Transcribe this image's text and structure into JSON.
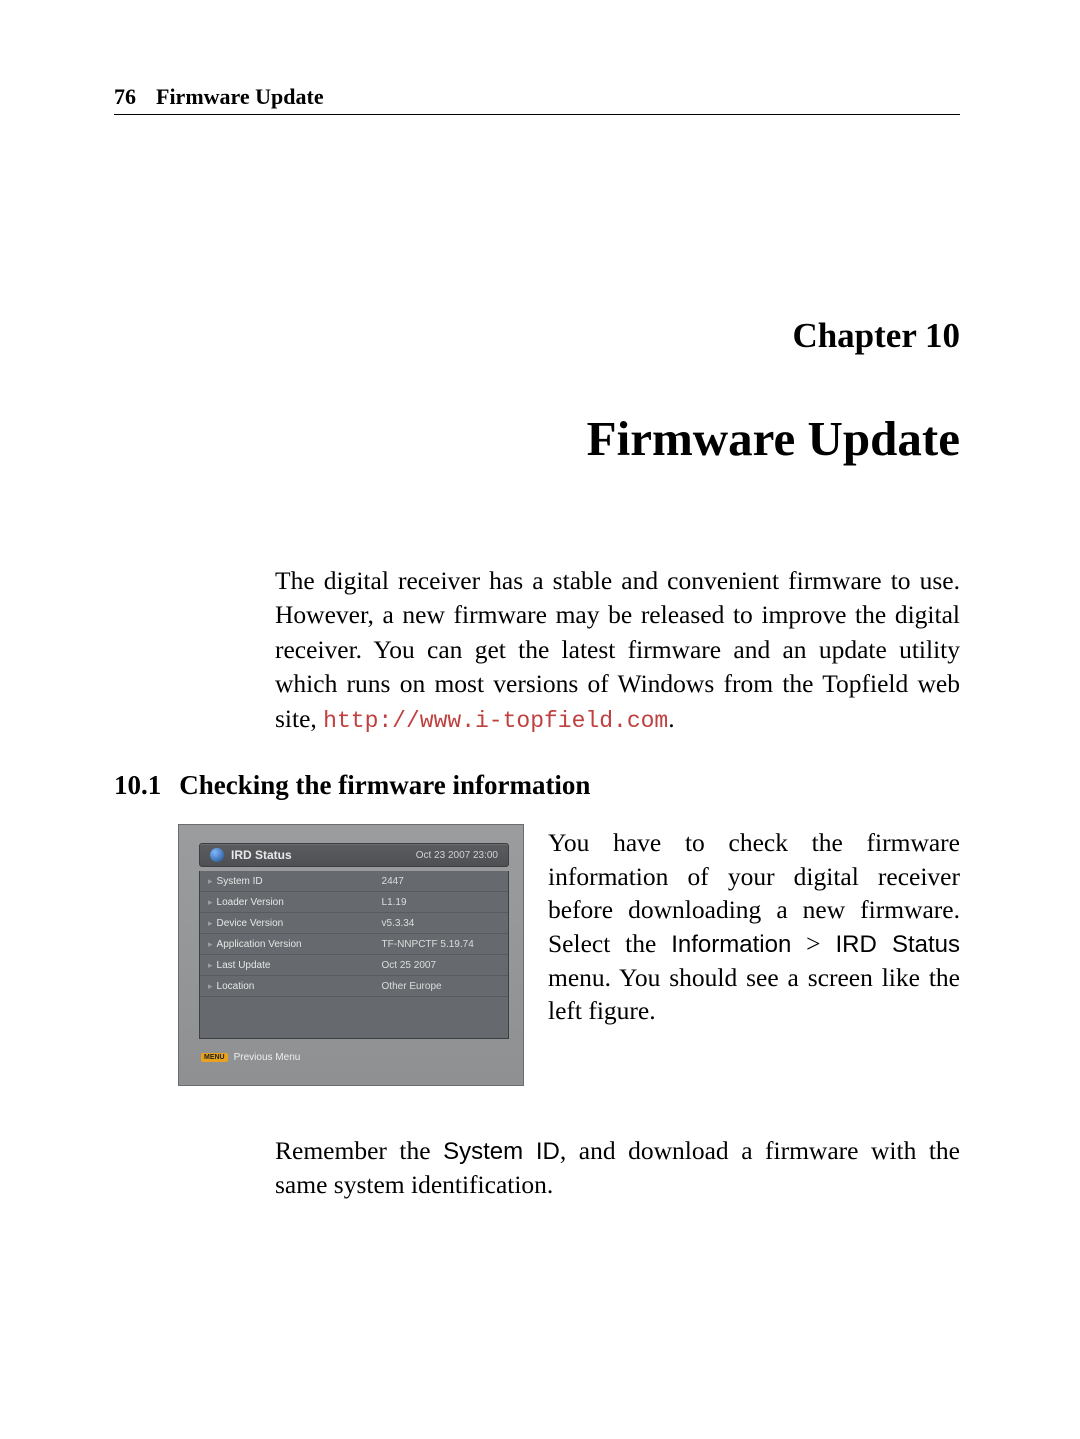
{
  "header": {
    "page_number": "76",
    "running_title": "Firmware Update"
  },
  "chapter": {
    "label": "Chapter 10",
    "title": "Firmware Update"
  },
  "intro": {
    "text_before_link": "The digital receiver has a stable and convenient firmware to use. However, a new firmware may be released to improve the digital receiver. You can get the latest firmware and an update utility which runs on most versions of Windows from the Topfield web site, ",
    "link_text": "http://www.i-topfield.com",
    "text_after_link": "."
  },
  "section": {
    "number": "10.1",
    "title": "Checking the firmware information"
  },
  "side_paragraph": {
    "part1": "You have to check the firmware information of your digital receiver before downloading a new firmware. Select the ",
    "menu1": "Information",
    "gt": " > ",
    "menu2": "IRD Status",
    "part2": " menu. You should see a screen like the left figure."
  },
  "after_paragraph": {
    "part1": "Remember the ",
    "term": "System ID",
    "part2": ", and download a firmware with the same system identification."
  },
  "ird": {
    "title": "IRD Status",
    "timestamp": "Oct 23 2007 23:00",
    "rows": [
      {
        "k": "System ID",
        "v": "2447"
      },
      {
        "k": "Loader Version",
        "v": "L1.19"
      },
      {
        "k": "Device Version",
        "v": "v5.3.34"
      },
      {
        "k": "Application Version",
        "v": "TF-NNPCTF 5.19.74"
      },
      {
        "k": "Last Update",
        "v": "Oct 25 2007"
      },
      {
        "k": "Location",
        "v": "Other Europe"
      }
    ],
    "footer_tag": "MENU",
    "footer_label": "Previous Menu"
  }
}
